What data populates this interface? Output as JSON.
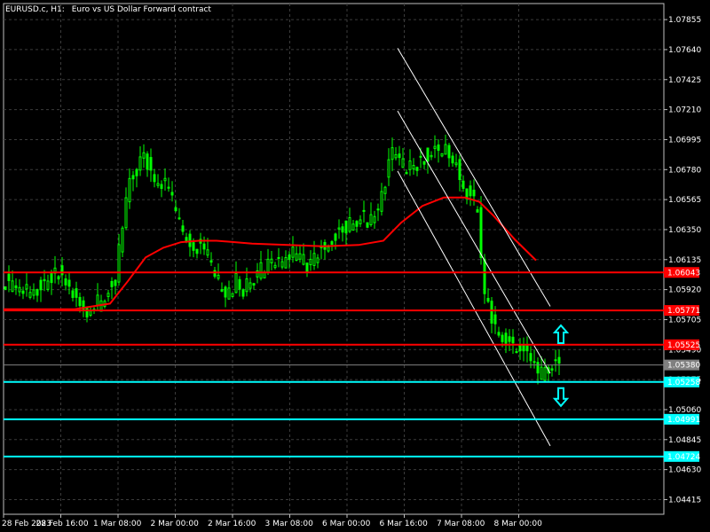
{
  "header": {
    "symbol": "EURUSD.c, H1:",
    "description": "Euro vs US Dollar Forward contract"
  },
  "chart_data": {
    "type": "candlestick",
    "symbol": "EURUSD.c",
    "timeframe": "H1",
    "ylim": [
      1.0431,
      1.0797
    ],
    "grid": true,
    "grid_style": "dashed",
    "colors": {
      "background": "#000000",
      "candles": "#00ff00",
      "moving_average": "#ff0000",
      "grid": "#3c3c3c",
      "axis_text": "#ffffff",
      "channel_lines": "#ffffff",
      "resistance_lines": "#ff0000",
      "support_lines": "#00ffff",
      "current_price": "#808080",
      "arrows": "#00ffff"
    },
    "y_ticks": [
      "1.07855",
      "1.07640",
      "1.07425",
      "1.07210",
      "1.06995",
      "1.06780",
      "1.06565",
      "1.06350",
      "1.06135",
      "1.05920",
      "1.05705",
      "1.05490",
      "1.05275",
      "1.05060",
      "1.04845",
      "1.04630",
      "1.04415"
    ],
    "x_ticks": [
      "28 Feb 2023",
      "28 Feb 16:00",
      "1 Mar 08:00",
      "2 Mar 00:00",
      "2 Mar 16:00",
      "3 Mar 08:00",
      "6 Mar 00:00",
      "6 Mar 16:00",
      "7 Mar 08:00",
      "8 Mar 00:00"
    ],
    "price_path": [
      [
        0,
        1.06
      ],
      [
        4,
        1.0592
      ],
      [
        8,
        1.059
      ],
      [
        12,
        1.0596
      ],
      [
        16,
        1.0604
      ],
      [
        18,
        1.0597
      ],
      [
        22,
        1.0582
      ],
      [
        24,
        1.0578
      ],
      [
        28,
        1.0584
      ],
      [
        32,
        1.06
      ],
      [
        34,
        1.064
      ],
      [
        36,
        1.0668
      ],
      [
        38,
        1.0678
      ],
      [
        40,
        1.0688
      ],
      [
        42,
        1.0675
      ],
      [
        44,
        1.0665
      ],
      [
        46,
        1.0668
      ],
      [
        48,
        1.0655
      ],
      [
        50,
        1.064
      ],
      [
        52,
        1.0628
      ],
      [
        54,
        1.0622
      ],
      [
        56,
        1.0625
      ],
      [
        58,
        1.0615
      ],
      [
        60,
        1.0604
      ],
      [
        62,
        1.059
      ],
      [
        64,
        1.0592
      ],
      [
        66,
        1.0598
      ],
      [
        68,
        1.0592
      ],
      [
        70,
        1.0598
      ],
      [
        72,
        1.0604
      ],
      [
        74,
        1.0608
      ],
      [
        76,
        1.0612
      ],
      [
        78,
        1.0612
      ],
      [
        80,
        1.0614
      ],
      [
        82,
        1.0618
      ],
      [
        84,
        1.0615
      ],
      [
        86,
        1.061
      ],
      [
        88,
        1.0612
      ],
      [
        90,
        1.0622
      ],
      [
        92,
        1.0626
      ],
      [
        94,
        1.0632
      ],
      [
        96,
        1.0636
      ],
      [
        98,
        1.064
      ],
      [
        100,
        1.0642
      ],
      [
        102,
        1.0645
      ],
      [
        104,
        1.064
      ],
      [
        106,
        1.065
      ],
      [
        108,
        1.067
      ],
      [
        110,
        1.069
      ],
      [
        112,
        1.0685
      ],
      [
        114,
        1.0678
      ],
      [
        116,
        1.068
      ],
      [
        118,
        1.0685
      ],
      [
        120,
        1.069
      ],
      [
        122,
        1.069
      ],
      [
        124,
        1.0695
      ],
      [
        126,
        1.069
      ],
      [
        128,
        1.068
      ],
      [
        130,
        1.0665
      ],
      [
        132,
        1.066
      ],
      [
        134,
        1.065
      ],
      [
        135,
        1.061
      ],
      [
        136,
        1.059
      ],
      [
        138,
        1.057
      ],
      [
        140,
        1.056
      ],
      [
        142,
        1.0555
      ],
      [
        144,
        1.0552
      ],
      [
        146,
        1.0548
      ],
      [
        148,
        1.0545
      ],
      [
        150,
        1.0535
      ],
      [
        152,
        1.0532
      ],
      [
        154,
        1.0535
      ],
      [
        156,
        1.0538
      ]
    ],
    "x_max_index": 186,
    "moving_average": [
      [
        0,
        1.0578
      ],
      [
        20,
        1.0578
      ],
      [
        30,
        1.0582
      ],
      [
        35,
        1.0598
      ],
      [
        40,
        1.0615
      ],
      [
        45,
        1.0622
      ],
      [
        50,
        1.0626
      ],
      [
        55,
        1.0627
      ],
      [
        60,
        1.0627
      ],
      [
        70,
        1.0625
      ],
      [
        80,
        1.0624
      ],
      [
        90,
        1.0623
      ],
      [
        100,
        1.0624
      ],
      [
        107,
        1.0627
      ],
      [
        112,
        1.064
      ],
      [
        118,
        1.0652
      ],
      [
        124,
        1.0658
      ],
      [
        130,
        1.0658
      ],
      [
        134,
        1.0655
      ],
      [
        138,
        1.0645
      ],
      [
        144,
        1.0628
      ],
      [
        150,
        1.0613
      ]
    ],
    "channel_lines": [
      {
        "x1": 111,
        "y1": 1.0765,
        "x2": 154,
        "y2": 1.058
      },
      {
        "x1": 111,
        "y1": 1.072,
        "x2": 154,
        "y2": 1.0532
      },
      {
        "x1": 111,
        "y1": 1.0677,
        "x2": 154,
        "y2": 1.048
      }
    ],
    "price_levels": [
      {
        "label": "1.06043",
        "value": 1.06043,
        "kind": "resistance"
      },
      {
        "label": "1.05771",
        "value": 1.05771,
        "kind": "resistance"
      },
      {
        "label": "1.05525",
        "value": 1.05525,
        "kind": "resistance"
      },
      {
        "label": "1.05380",
        "value": 1.0538,
        "kind": "current"
      },
      {
        "label": "1.05258",
        "value": 1.05258,
        "kind": "support"
      },
      {
        "label": "1.04991",
        "value": 1.04991,
        "kind": "support"
      },
      {
        "label": "1.04724",
        "value": 1.04724,
        "kind": "support"
      }
    ],
    "arrows": [
      {
        "direction": "up",
        "x": 157,
        "value": 1.056
      },
      {
        "direction": "down",
        "x": 157,
        "value": 1.0515
      }
    ]
  }
}
